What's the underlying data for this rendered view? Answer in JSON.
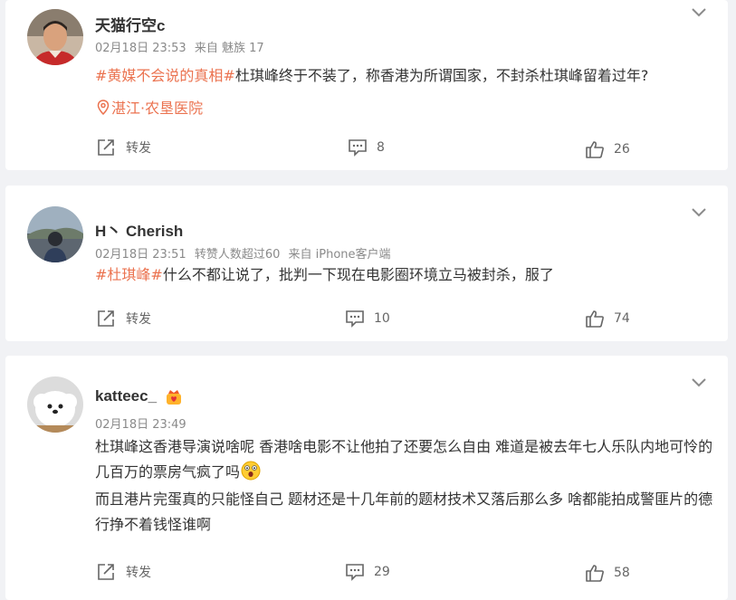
{
  "posts": [
    {
      "username": "天猫行空c",
      "meta": [
        "02月18日 23:53",
        "来自 魅族 17"
      ],
      "tag": "#黄媒不会说的真相#",
      "text": "杜琪峰终于不装了，称香港为所谓国家，不封杀杜琪峰留着过年?",
      "location": "湛江·农垦医院",
      "repost_label": "转发",
      "comments": "8",
      "likes": "26"
    },
    {
      "username": "H丶 Cherish",
      "meta": [
        "02月18日 23:51",
        "转赞人数超过60",
        "来自 iPhone客户端"
      ],
      "tag": "#杜琪峰#",
      "text": "什么不都让说了，批判一下现在电影圈环境立马被封杀，服了",
      "repost_label": "转发",
      "comments": "10",
      "likes": "74"
    },
    {
      "username": "katteec_",
      "meta": [
        "02月18日 23:49"
      ],
      "text_line1": "杜琪峰这香港导演说啥呢 香港啥电影不让他拍了还要怎么自由 难道是被去年七人乐队内地可怜的几百万的票房气疯了吗",
      "text_line2": "而且港片完蛋真的只能怪自己 题材还是十几年前的题材技术又落后那么多 啥都能拍成警匪片的德行挣不着钱怪谁啊",
      "repost_label": "转发",
      "comments": "29",
      "likes": "58"
    }
  ],
  "colors": {
    "accent": "#eb7350",
    "meta": "#8a8a8a",
    "background": "#f1f2f5"
  }
}
